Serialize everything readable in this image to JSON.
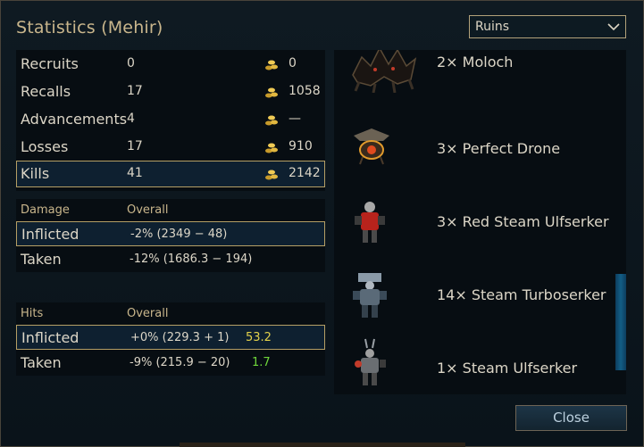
{
  "window": {
    "title": "Statistics (Mehir)"
  },
  "filter": {
    "selected": "Ruins"
  },
  "summary": [
    {
      "label": "Recruits",
      "count": "0",
      "gold": "0",
      "highlighted": false
    },
    {
      "label": "Recalls",
      "count": "17",
      "gold": "1058",
      "highlighted": false
    },
    {
      "label": "Advancements",
      "count": "4",
      "gold": "—",
      "highlighted": false
    },
    {
      "label": "Losses",
      "count": "17",
      "gold": "910",
      "highlighted": false
    },
    {
      "label": "Kills",
      "count": "41",
      "gold": "2142",
      "highlighted": true
    }
  ],
  "damage": {
    "header": "Damage",
    "overall_header": "Overall",
    "rows": [
      {
        "label": "Inflicted",
        "value": "-2% (2349 − 48)",
        "extra": "",
        "highlighted": true
      },
      {
        "label": "Taken",
        "value": "-12% (1686.3 − 194)",
        "extra": "",
        "highlighted": false
      }
    ]
  },
  "hits": {
    "header": "Hits",
    "overall_header": "Overall",
    "rows": [
      {
        "label": "Inflicted",
        "value": "+0% (229.3 + 1)",
        "extra": "53.2",
        "extra_color": "yellow",
        "highlighted": true
      },
      {
        "label": "Taken",
        "value": "-9% (215.9 − 20)",
        "extra": "1.7",
        "extra_color": "green",
        "highlighted": false
      }
    ]
  },
  "units": [
    {
      "name": "2× Moloch",
      "icon": "moloch-sprite-icon"
    },
    {
      "name": "3× Perfect Drone",
      "icon": "drone-sprite-icon"
    },
    {
      "name": "3× Red Steam Ulfserker",
      "icon": "red-ulfserker-sprite-icon"
    },
    {
      "name": "14× Steam Turboserker",
      "icon": "turboserker-sprite-icon"
    },
    {
      "name": "1× Steam Ulfserker",
      "icon": "ulfserker-sprite-icon"
    }
  ],
  "actions": {
    "close_label": "Close"
  },
  "colors": {
    "accent_gold": "#c9b68c",
    "highlight_border": "#b59f65",
    "positive": "#6fd63a",
    "gold_value": "#e3d24b"
  }
}
